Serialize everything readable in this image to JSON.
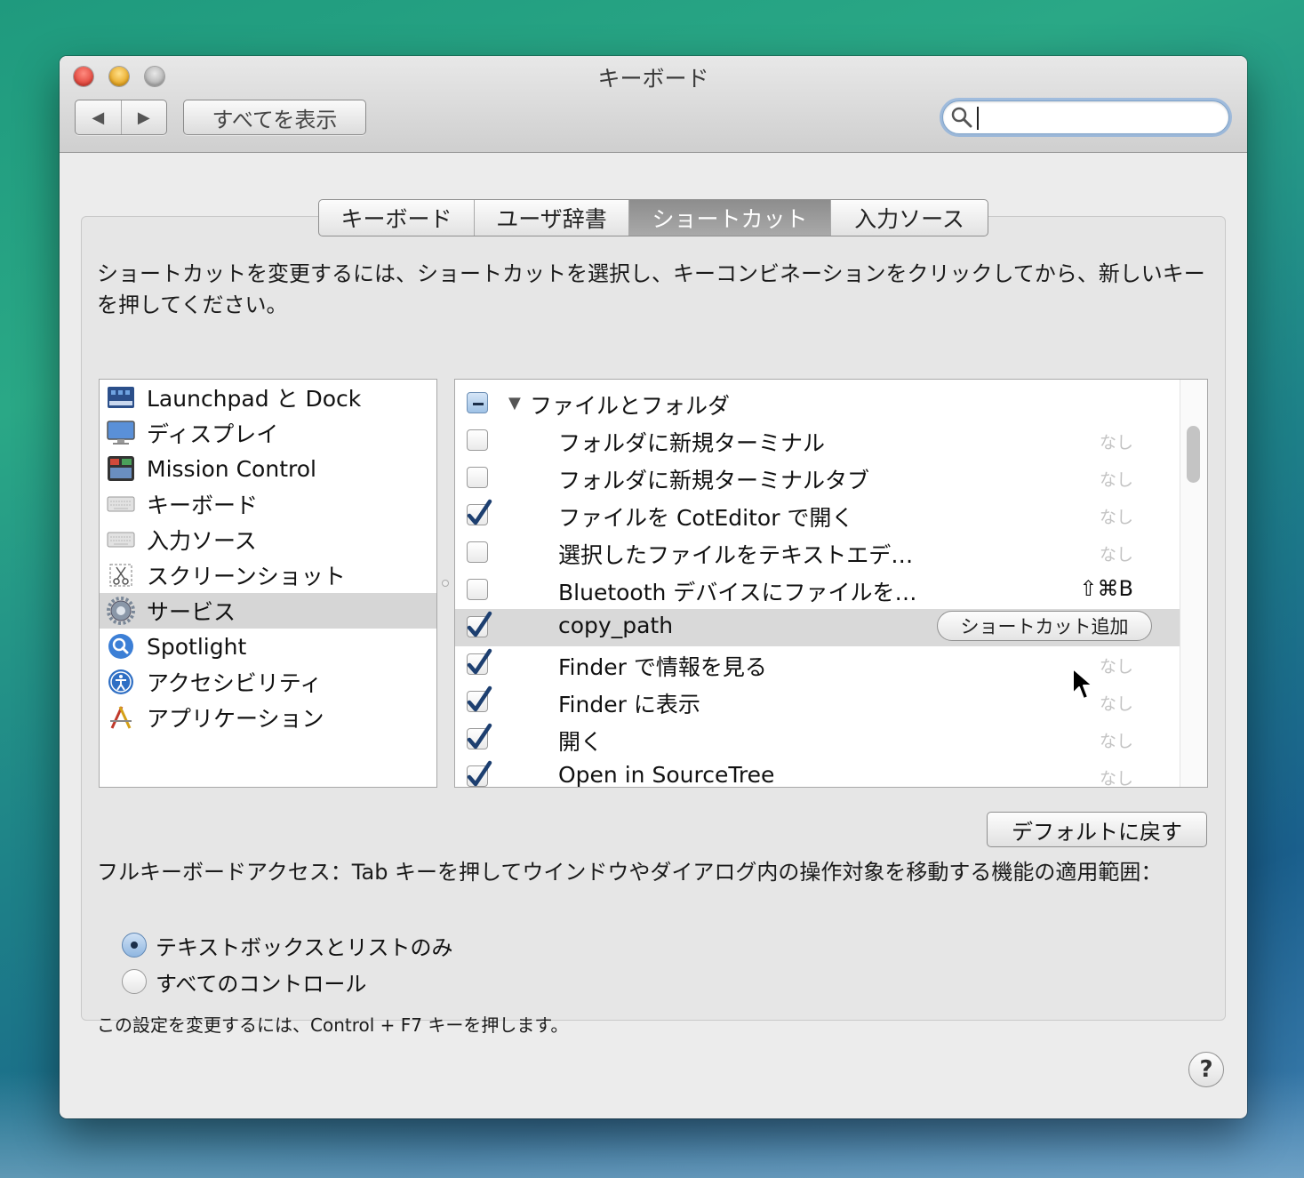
{
  "window": {
    "title": "キーボード"
  },
  "toolbar": {
    "back_glyph": "◀",
    "forward_glyph": "▶",
    "show_all_label": "すべてを表示",
    "search_value": ""
  },
  "tabs": [
    {
      "label": "キーボード",
      "active": false
    },
    {
      "label": "ユーザ辞書",
      "active": false
    },
    {
      "label": "ショートカット",
      "active": true
    },
    {
      "label": "入力ソース",
      "active": false
    }
  ],
  "intro_text": "ショートカットを変更するには、ショートカットを選択し、キーコンビネーションをクリックしてから、新しいキーを押してください。",
  "categories": [
    {
      "label": "Launchpad と Dock",
      "icon": "launchpad-icon",
      "selected": false
    },
    {
      "label": "ディスプレイ",
      "icon": "display-icon",
      "selected": false
    },
    {
      "label": "Mission Control",
      "icon": "mission-control-icon",
      "selected": false
    },
    {
      "label": "キーボード",
      "icon": "keyboard-icon",
      "selected": false
    },
    {
      "label": "入力ソース",
      "icon": "input-source-icon",
      "selected": false
    },
    {
      "label": "スクリーンショット",
      "icon": "screenshot-icon",
      "selected": false
    },
    {
      "label": "サービス",
      "icon": "gear-icon",
      "selected": true
    },
    {
      "label": "Spotlight",
      "icon": "spotlight-icon",
      "selected": false
    },
    {
      "label": "アクセシビリティ",
      "icon": "accessibility-icon",
      "selected": false
    },
    {
      "label": "アプリケーション",
      "icon": "app-store-icon",
      "selected": false
    }
  ],
  "services": {
    "group": {
      "label": "ファイルとフォルダ",
      "state": "mixed"
    },
    "items": [
      {
        "label": "フォルダに新規ターミナル",
        "checked": false,
        "shortcut": "なし"
      },
      {
        "label": "フォルダに新規ターミナルタブ",
        "checked": false,
        "shortcut": "なし"
      },
      {
        "label": "ファイルを CotEditor で開く",
        "checked": true,
        "shortcut": "なし"
      },
      {
        "label": "選択したファイルをテキストエデ…",
        "checked": false,
        "shortcut": "なし"
      },
      {
        "label": "Bluetooth デバイスにファイルを…",
        "checked": false,
        "shortcut": "⇧⌘B"
      },
      {
        "label": "copy_path",
        "checked": true,
        "shortcut": "",
        "add_label": "ショートカット追加"
      },
      {
        "label": "Finder で情報を見る",
        "checked": true,
        "shortcut": "なし"
      },
      {
        "label": "Finder に表示",
        "checked": true,
        "shortcut": "なし"
      },
      {
        "label": "開く",
        "checked": true,
        "shortcut": "なし"
      },
      {
        "label": "Open in SourceTree",
        "checked": true,
        "shortcut": "なし"
      }
    ]
  },
  "restore_defaults_label": "デフォルトに戻す",
  "full_keyboard_access": {
    "text": "フルキーボードアクセス：Tab キーを押してウインドウやダイアログ内の操作対象を移動する機能の適用範囲：",
    "options": [
      {
        "label": "テキストボックスとリストのみ",
        "selected": true
      },
      {
        "label": "すべてのコントロール",
        "selected": false
      }
    ],
    "note": "この設定を変更するには、Control + F7 キーを押します。"
  },
  "help_label": "?",
  "colors": {
    "accent": "#6ea0dc",
    "selected_row": "#d6d6d6",
    "close": "#e0443a",
    "minimize": "#e6a520"
  }
}
